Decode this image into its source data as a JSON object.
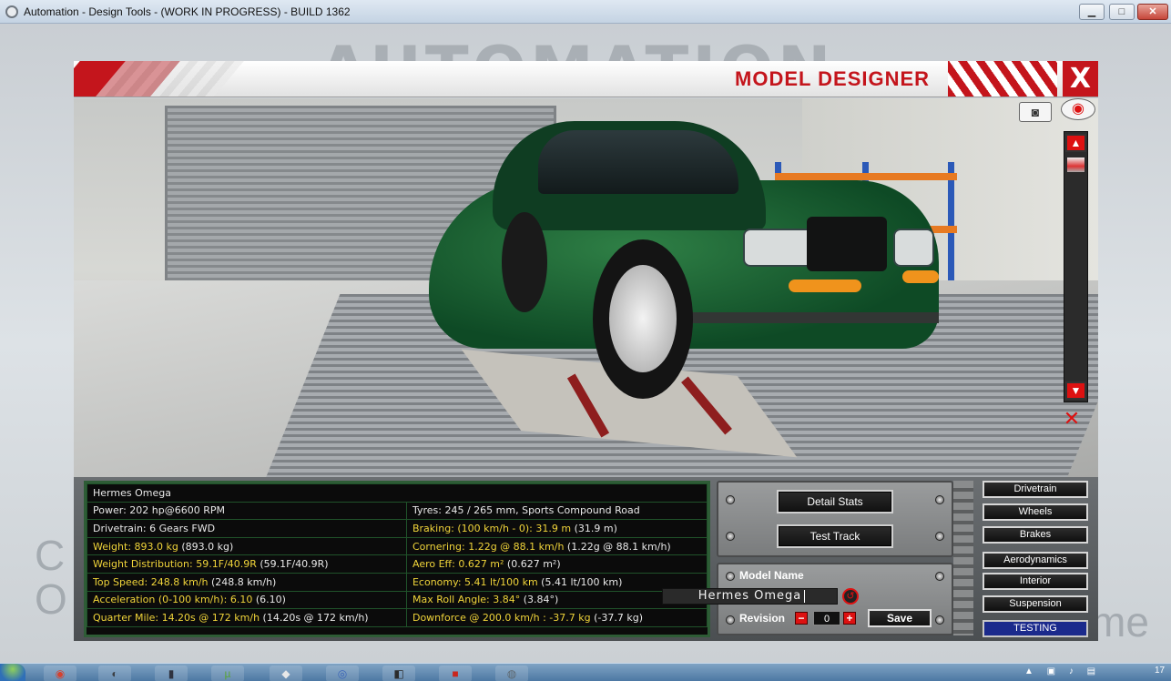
{
  "window": {
    "title": "Automation - Design Tools - (WORK IN PROGRESS) - BUILD 1362",
    "minimize": "▁",
    "maximize": "□",
    "close": "✕"
  },
  "backdrop": {
    "logo_text": "AUTOMATION",
    "left_letters_line1": "C",
    "left_letters_line2": "O",
    "right_letters": "me"
  },
  "header": {
    "title": "MODEL DESIGNER",
    "close_label": "X"
  },
  "viewport": {
    "camera_icon": "camera-icon",
    "eye_icon": "eye-icon",
    "scroll_up": "▲",
    "scroll_down": "▼",
    "recenter_icon": "recenter-icon",
    "camera_glyph": "◙",
    "eye_glyph": "◉",
    "recenter_glyph": "✕"
  },
  "stats": {
    "model_name": "Hermes Omega",
    "rows": [
      {
        "left_label": "Power: 202 hp@6600 RPM",
        "left_paren": "",
        "left_hi": false,
        "right_label": "Tyres: 245 / 265 mm, Sports Compound Road",
        "right_paren": "",
        "right_hi": false
      },
      {
        "left_label": "Drivetrain: 6 Gears FWD",
        "left_paren": "",
        "left_hi": false,
        "right_label": "Braking: (100 km/h - 0): 31.9 m",
        "right_paren": " (31.9 m)",
        "right_hi": true
      },
      {
        "left_label": "Weight: 893.0 kg",
        "left_paren": " (893.0 kg)",
        "left_hi": true,
        "right_label": "Cornering: 1.22g @ 88.1 km/h",
        "right_paren": " (1.22g @ 88.1 km/h)",
        "right_hi": true
      },
      {
        "left_label": "Weight Distribution: 59.1F/40.9R",
        "left_paren": " (59.1F/40.9R)",
        "left_hi": true,
        "right_label": "Aero Eff: 0.627 m²",
        "right_paren": " (0.627 m²)",
        "right_hi": true
      },
      {
        "left_label": "Top Speed: 248.8 km/h",
        "left_paren": " (248.8 km/h)",
        "left_hi": true,
        "right_label": "Economy: 5.41 lt/100 km",
        "right_paren": " (5.41 lt/100 km)",
        "right_hi": true
      },
      {
        "left_label": "Acceleration (0-100 km/h): 6.10",
        "left_paren": " (6.10)",
        "left_hi": true,
        "right_label": "Max Roll Angle: 3.84°",
        "right_paren": " (3.84°)",
        "right_hi": true
      },
      {
        "left_label": "Quarter Mile: 14.20s @ 172 km/h",
        "left_paren": " (14.20s @ 172 km/h)",
        "left_hi": true,
        "right_label": "Downforce @ 200.0 km/h : -37.7 kg",
        "right_paren": " (-37.7 kg)",
        "right_hi": true
      }
    ]
  },
  "actions": {
    "detail_stats": "Detail Stats",
    "test_track": "Test Track"
  },
  "model_form": {
    "model_name_label": "Model Name",
    "model_name_value": "Hermes Omega",
    "revision_label": "Revision",
    "revision_value": "0",
    "minus": "−",
    "plus": "+",
    "save": "Save",
    "reset_glyph": "↺"
  },
  "side_tabs": [
    "Drivetrain",
    "Wheels",
    "Brakes",
    "Aerodynamics",
    "Interior",
    "Suspension",
    "TESTING"
  ],
  "active_tab": "TESTING",
  "taskbar": {
    "clock": "17",
    "tray": "▲ ▣ ♪ ▤",
    "apps": [
      {
        "name": "chrome-icon",
        "glyph": "◉",
        "color": "#d4412f"
      },
      {
        "name": "steam-icon",
        "glyph": "◐",
        "color": "#3b3f44"
      },
      {
        "name": "document-icon",
        "glyph": "▮",
        "color": "#2f3340"
      },
      {
        "name": "utorrent-icon",
        "glyph": "µ",
        "color": "#5aa33a"
      },
      {
        "name": "fox-icon",
        "glyph": "◆",
        "color": "#e8e8e8"
      },
      {
        "name": "headset-icon",
        "glyph": "◎",
        "color": "#3a64b8"
      },
      {
        "name": "tool-icon",
        "glyph": "◧",
        "color": "#2b2b2b"
      },
      {
        "name": "app-red-icon",
        "glyph": "■",
        "color": "#c9261d"
      },
      {
        "name": "automation-icon",
        "glyph": "◍",
        "color": "#5d6870"
      }
    ]
  },
  "colors": {
    "accent_red": "#c4151c",
    "stats_highlight": "#f0d43a",
    "active_tab": "#1b2a8c"
  }
}
